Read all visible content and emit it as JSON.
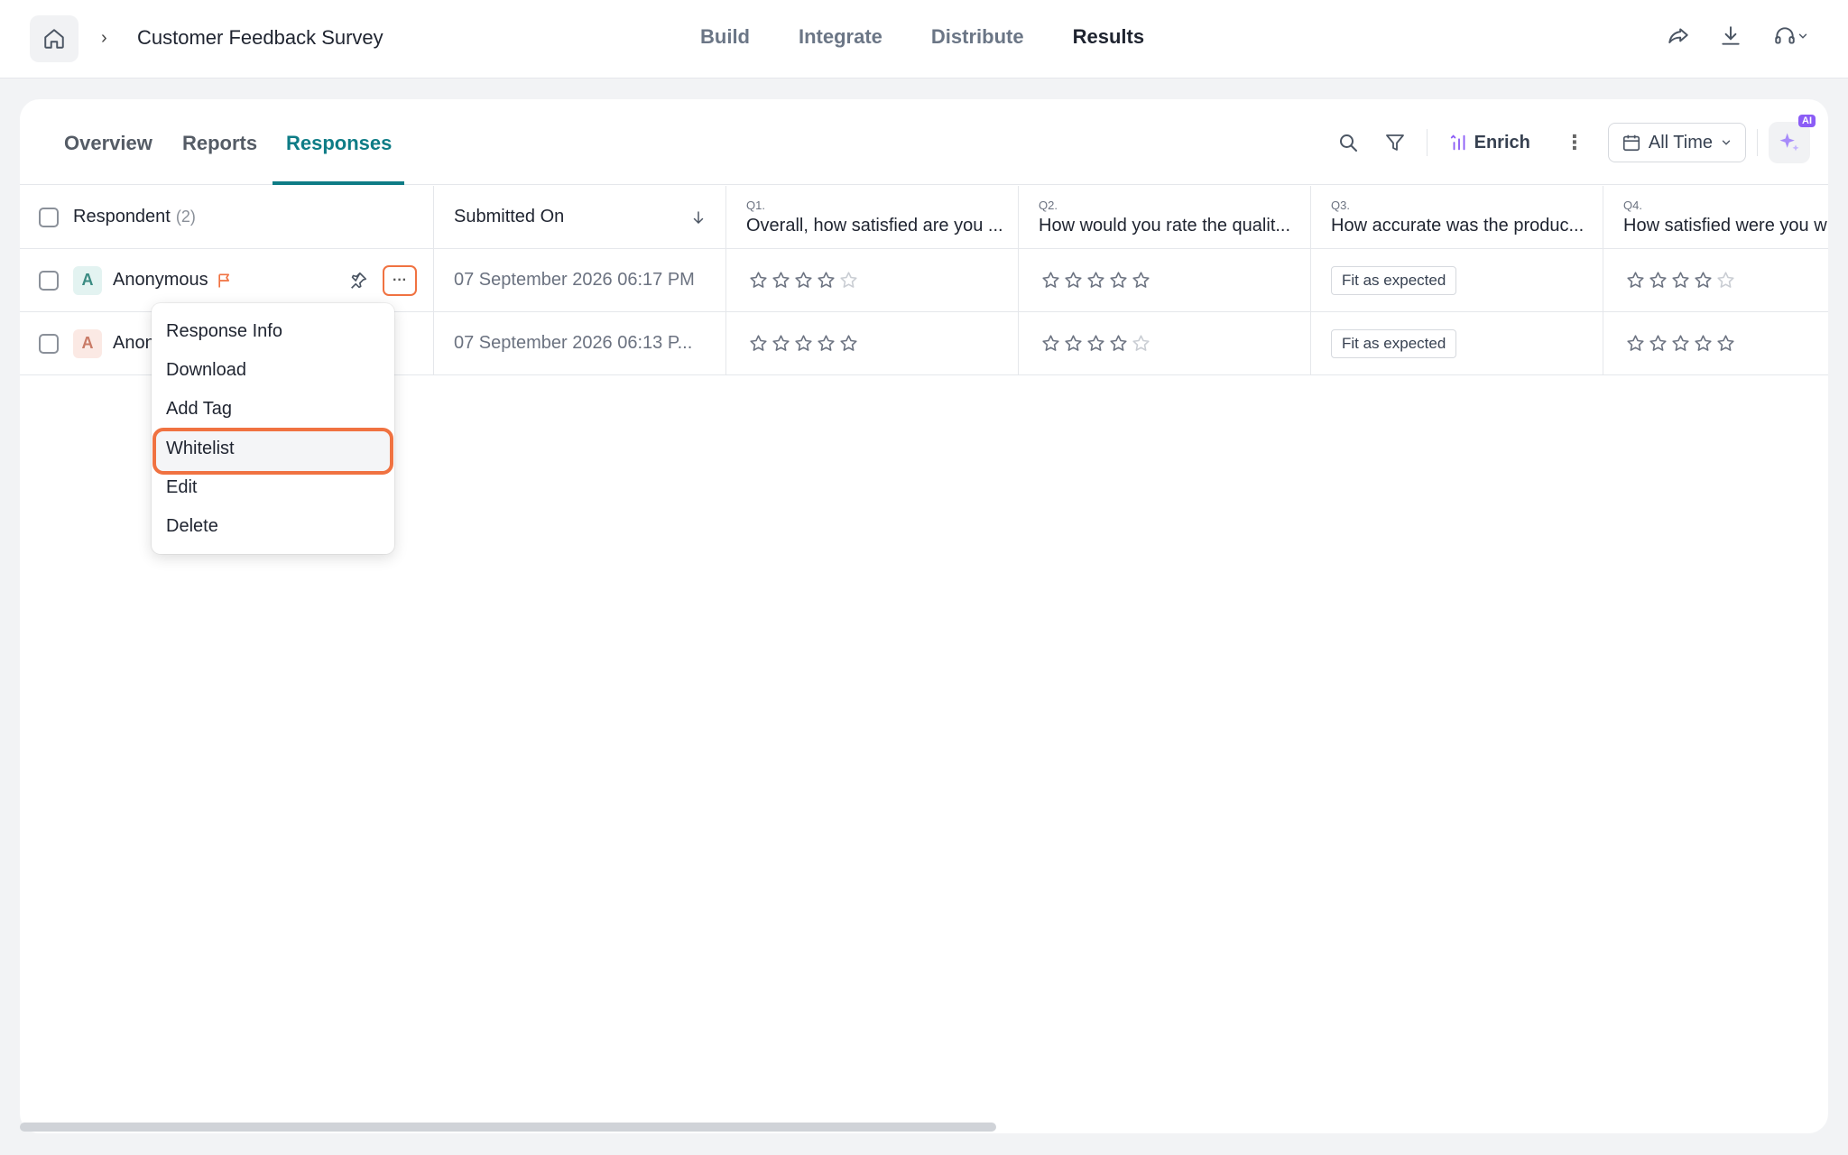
{
  "topbar": {
    "survey_title": "Customer Feedback Survey",
    "nav": [
      "Build",
      "Integrate",
      "Distribute",
      "Results"
    ],
    "active_nav": "Results"
  },
  "subtabs": {
    "items": [
      "Overview",
      "Reports",
      "Responses"
    ],
    "active": "Responses"
  },
  "toolbar": {
    "enrich_label": "Enrich",
    "date_filter": "All Time",
    "ai_badge": "AI"
  },
  "table": {
    "headers": {
      "respondent": "Respondent",
      "respondent_count": "(2)",
      "submitted_on": "Submitted On",
      "questions": [
        {
          "num": "Q1.",
          "text": "Overall, how satisfied are you ..."
        },
        {
          "num": "Q2.",
          "text": "How would you rate the qualit..."
        },
        {
          "num": "Q3.",
          "text": "How accurate was the produc..."
        },
        {
          "num": "Q4.",
          "text": "How satisfied were you w"
        }
      ]
    },
    "rows": [
      {
        "avatar": "A",
        "name": "Anonymous",
        "date": "07 September 2026 06:17 PM",
        "q1_stars": 4,
        "q2_stars": 5,
        "q3": "Fit as expected",
        "q4_stars": 4
      },
      {
        "avatar": "A",
        "name": "Anon",
        "date": "07 September 2026 06:13 P...",
        "q1_stars": 5,
        "q2_stars": 4,
        "q3": "Fit as expected",
        "q4_stars": 5
      }
    ]
  },
  "row_menu": {
    "items": [
      "Response Info",
      "Download",
      "Add Tag",
      "Whitelist",
      "Edit",
      "Delete"
    ],
    "highlighted": "Whitelist"
  },
  "colors": {
    "accent": "#0e7c86",
    "highlight": "#f07241",
    "flag": "#f07241"
  }
}
